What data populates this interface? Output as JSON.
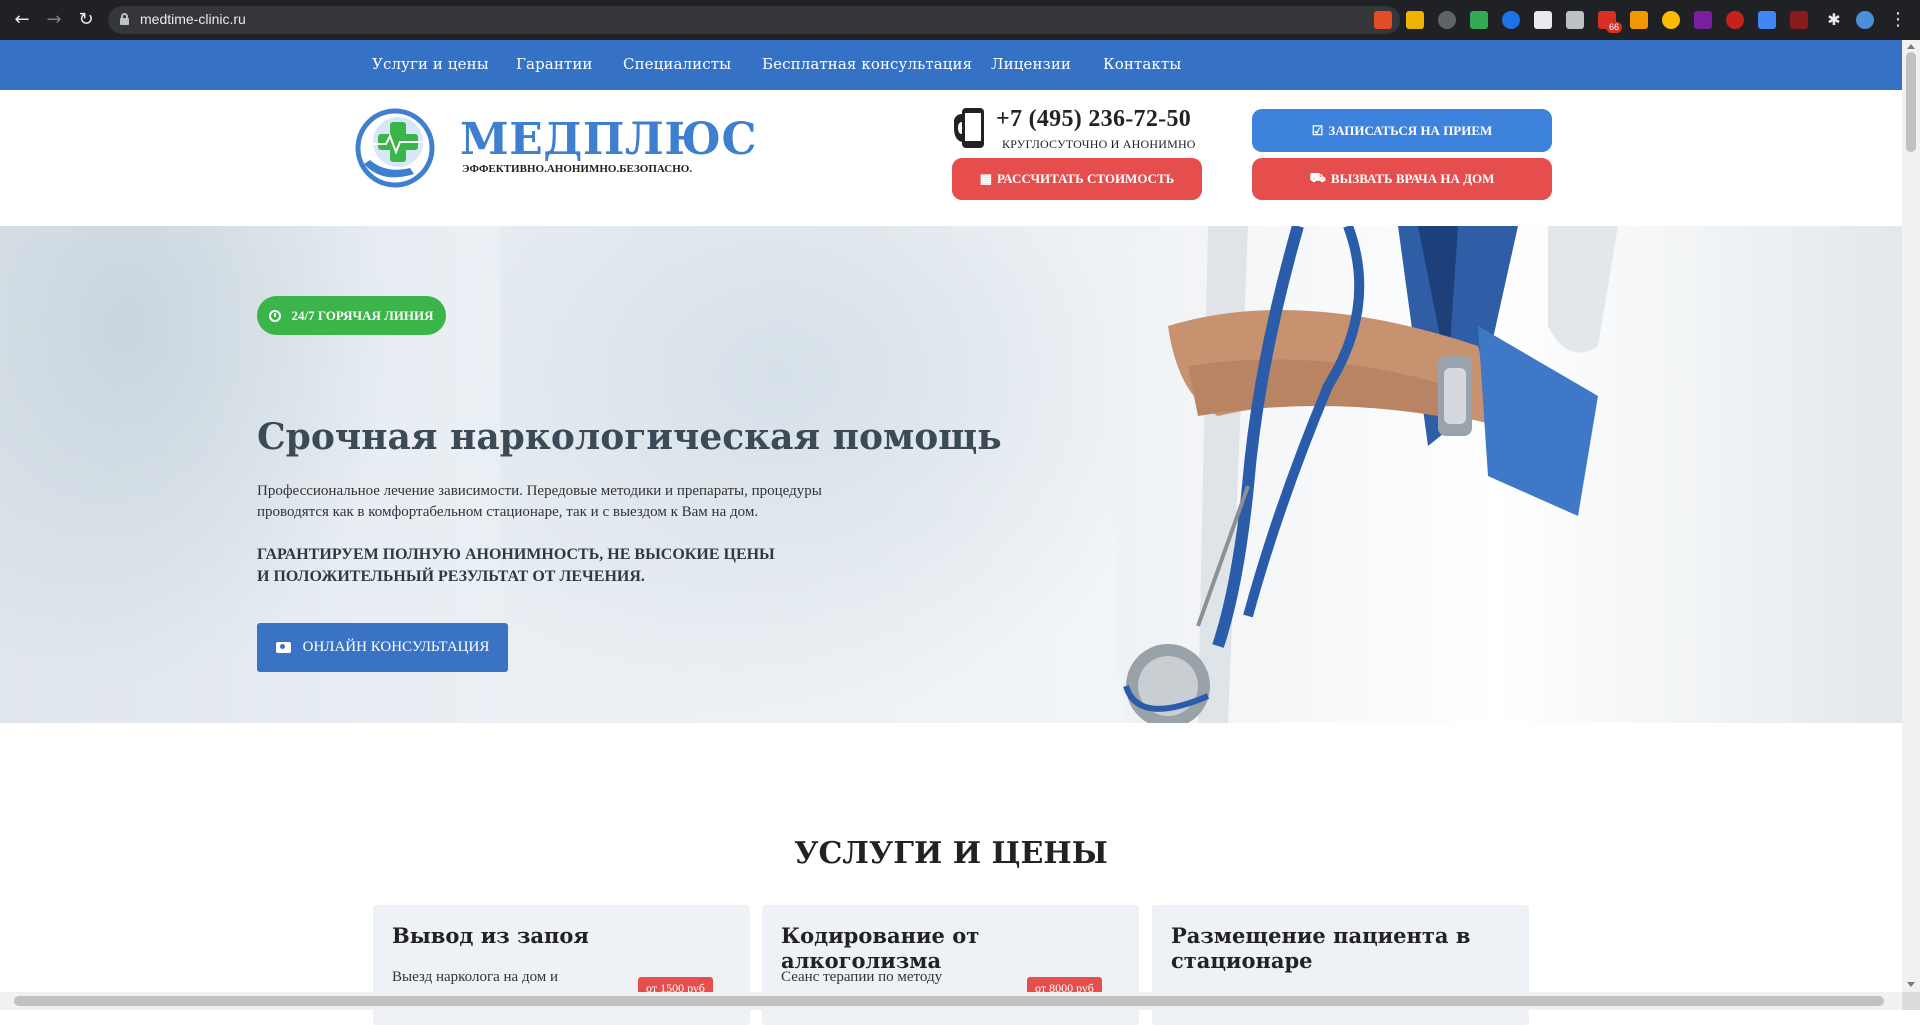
{
  "browser": {
    "url": "medtime-clinic.ru",
    "extension_badge": "66"
  },
  "nav": {
    "items": [
      "Услуги и цены",
      "Гарантии",
      "Специалисты",
      "Бесплатная консультация",
      "Лицензии",
      "Контакты"
    ]
  },
  "header": {
    "logo_title": "МЕДПЛЮС",
    "logo_subtitle": "ЭФФЕКТИВНО.АНОНИМНО.БЕЗОПАСНО.",
    "phone": "+7 (495) 236-72-50",
    "phone_sub": "КРУГЛОСУТОЧНО И АНОНИМНО",
    "btn_calc": "РАССЧИТАТЬ СТОИМОСТЬ",
    "btn_appointment": "ЗАПИСАТЬСЯ НА ПРИЕМ",
    "btn_home_doctor": "ВЫЗВАТЬ ВРАЧА НА ДОМ"
  },
  "hero": {
    "hotline": "24/7 ГОРЯЧАЯ ЛИНИЯ",
    "title": "Срочная наркологическая помощь",
    "desc_line1": "Профессиональное  лечение зависимости. Передовые методики и препараты, процедуры",
    "desc_line2": "проводятся как в комфортабельном стационаре, так и с выездом к Вам на дом.",
    "guarantee_line1": "ГАРАНТИРУЕМ ПОЛНУЮ АНОНИМНОСТЬ, НЕ ВЫСОКИЕ ЦЕНЫ",
    "guarantee_line2": "И ПОЛОЖИТЕЛЬНЫЙ РЕЗУЛЬТАТ ОТ ЛЕЧЕНИЯ.",
    "consult_button": "ОНЛАЙН КОНСУЛЬТАЦИЯ"
  },
  "services": {
    "title": "УСЛУГИ И ЦЕНЫ",
    "cards": [
      {
        "title": "Вывод из запоя",
        "desc": "Выезд нарколога на дом и",
        "price": "от 1500 руб"
      },
      {
        "title": "Кодирование от алкоголизма",
        "desc": "Сеанс терапии по методу",
        "price": "от 8000 руб"
      },
      {
        "title_line1": "Размещение пациента в",
        "title_line2": "стационаре"
      }
    ]
  },
  "colors": {
    "nav_blue": "#3572c6",
    "accent_red": "#e54e4c",
    "accent_blue": "#3d82dc",
    "hotline_green": "#3bb44a"
  }
}
